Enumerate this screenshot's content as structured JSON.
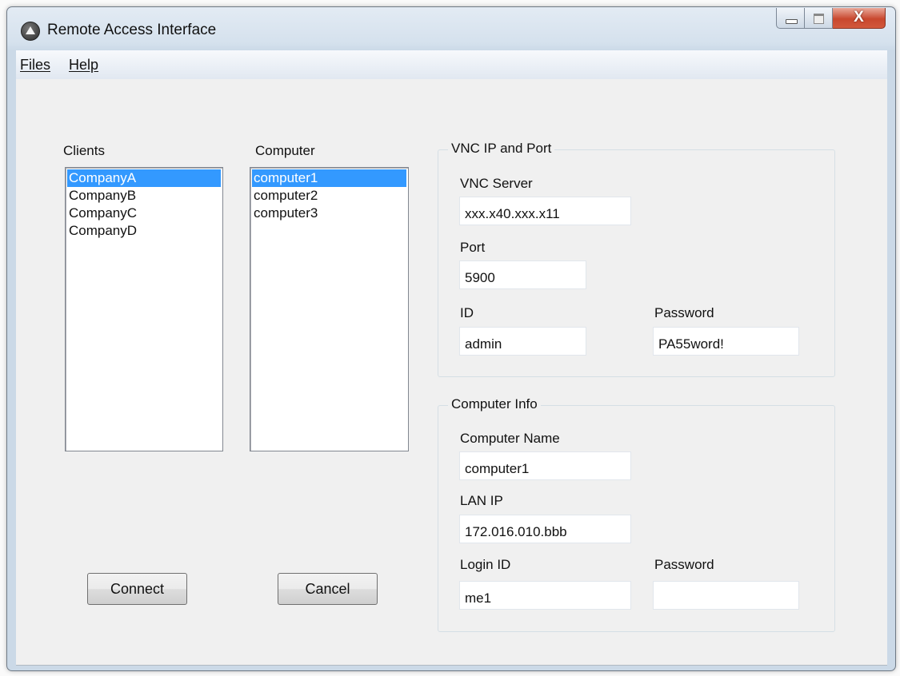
{
  "window": {
    "title": "Remote Access Interface",
    "close_glyph": "X"
  },
  "menu": {
    "files": "Files",
    "help": "Help"
  },
  "clients": {
    "label": "Clients",
    "items": [
      "CompanyA",
      "CompanyB",
      "CompanyC",
      "CompanyD"
    ],
    "selected": 0
  },
  "computers": {
    "label": "Computer",
    "items": [
      "computer1",
      "computer2",
      "computer3"
    ],
    "selected": 0
  },
  "vnc": {
    "group_title": "VNC IP and Port",
    "server_label": "VNC Server",
    "server_value": "xxx.x40.xxx.x11",
    "port_label": "Port",
    "port_value": "5900",
    "id_label": "ID",
    "id_value": "admin",
    "password_label": "Password",
    "password_value": "PA55word!"
  },
  "info": {
    "group_title": "Computer Info",
    "name_label": "Computer Name",
    "name_value": "computer1",
    "lanip_label": "LAN IP",
    "lanip_value": "172.016.010.bbb",
    "login_label": "Login ID",
    "login_value": "me1",
    "password_label": "Password",
    "password_value": ""
  },
  "buttons": {
    "connect": "Connect",
    "cancel": "Cancel"
  },
  "colors": {
    "selection": "#3399ff",
    "close_button": "#c8472e"
  },
  "icons": {
    "app": "remote-access-app-icon"
  }
}
